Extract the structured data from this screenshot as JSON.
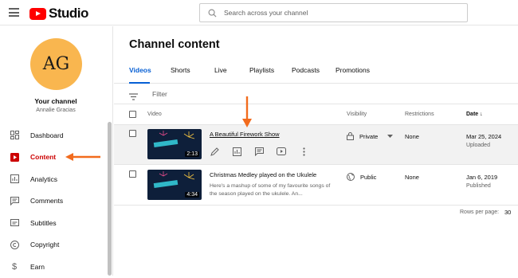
{
  "app": {
    "name": "Studio"
  },
  "search": {
    "placeholder": "Search across your channel"
  },
  "channel": {
    "avatar_initials": "AG",
    "label": "Your channel",
    "name": "Annalie Gracias"
  },
  "sidebar": {
    "items": [
      {
        "label": "Dashboard",
        "icon": "dashboard-icon"
      },
      {
        "label": "Content",
        "icon": "content-icon",
        "active": true
      },
      {
        "label": "Analytics",
        "icon": "analytics-icon"
      },
      {
        "label": "Comments",
        "icon": "comments-icon"
      },
      {
        "label": "Subtitles",
        "icon": "subtitles-icon"
      },
      {
        "label": "Copyright",
        "icon": "copyright-icon"
      },
      {
        "label": "Earn",
        "icon": "earn-icon"
      }
    ]
  },
  "page": {
    "title": "Channel content"
  },
  "tabs": [
    {
      "label": "Videos",
      "active": true
    },
    {
      "label": "Shorts"
    },
    {
      "label": "Live"
    },
    {
      "label": "Playlists"
    },
    {
      "label": "Podcasts"
    },
    {
      "label": "Promotions"
    }
  ],
  "filter": {
    "label": "Filter"
  },
  "table": {
    "headers": {
      "video": "Video",
      "visibility": "Visibility",
      "restrictions": "Restrictions",
      "date": "Date"
    },
    "rows": [
      {
        "duration": "2:13",
        "title": "A Beautiful Firework Show",
        "visibility": "Private",
        "restrictions": "None",
        "date": "Mar 25, 2024",
        "status": "Uploaded"
      },
      {
        "duration": "4:34",
        "title": "Christmas Medley played on the Ukulele",
        "description": "Here's a mashup of some of my favourite songs of the season played on the ukulele. An...",
        "visibility": "Public",
        "restrictions": "None",
        "date": "Jan 6, 2019",
        "status": "Published"
      }
    ]
  },
  "pagination": {
    "rows_per_page_label": "Rows per page:",
    "rows_per_page": "30"
  },
  "colors": {
    "brand": "#ff0000",
    "accent": "#065fd4",
    "active_nav": "#cc0000",
    "arrow": "#f26b1d",
    "avatar": "#f9b64f"
  }
}
